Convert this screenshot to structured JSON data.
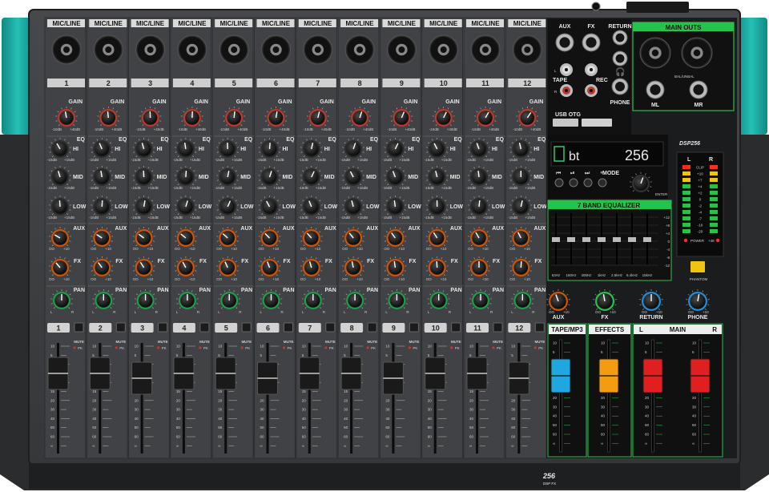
{
  "channels": {
    "input_label": "MIC/LINE",
    "numbers": [
      "1",
      "2",
      "3",
      "4",
      "5",
      "6",
      "7",
      "8",
      "9",
      "10",
      "11",
      "12"
    ],
    "gain_label": "GAIN",
    "gain_scale": [
      "-10dB",
      "+40dB"
    ],
    "eq_label": "EQ",
    "eq_bands": [
      "HI",
      "MID",
      "LOW"
    ],
    "eq_scale": [
      "-15dB",
      "+15dB"
    ],
    "aux_label": "AUX",
    "fx_label": "FX",
    "send_scale": [
      "OO",
      "+10"
    ],
    "pan_label": "PAN",
    "pan_scale": [
      "L",
      "R"
    ],
    "mute_label": "MUTE",
    "pk_label": "PK",
    "fader_scale": [
      "10",
      "5",
      "U",
      "5",
      "10",
      "15",
      "20",
      "30",
      "40",
      "50",
      "60",
      "∞"
    ]
  },
  "master": {
    "jacks": {
      "aux": "AUX",
      "fx": "FX",
      "return": "RETURN"
    },
    "main_outs": "MAIN OUTS",
    "tape": "TAPE",
    "rec": "REC",
    "phone": "PHONE",
    "bal_unbal": "BAL/UNBAL",
    "ml": "ML",
    "mr": "MR",
    "usb_otg": "USB OTG",
    "usb_port": "USB",
    "model": "DSP256",
    "display": {
      "left": "bt",
      "right": "256"
    },
    "mode": "MODE",
    "enter": "ENTER",
    "eq_title": "7 BAND EQUALIZER",
    "eq_freqs": [
      "63Hz",
      "160Hz",
      "400Hz",
      "1kHz",
      "2.5kHz",
      "6.4kHz",
      "15kHz"
    ],
    "eq_db": [
      "+12",
      "+8",
      "+4",
      "0",
      "-4",
      "-8",
      "-12"
    ],
    "meter_lr": [
      "L",
      "R"
    ],
    "meter_scale": [
      "CLIP",
      "+10",
      "+7",
      "+4",
      "+2",
      "0",
      "-2",
      "-4",
      "-7",
      "-10",
      "-20"
    ],
    "power": "POWER",
    "p48": "+48",
    "phantom": "PHANTOM",
    "knobs": [
      "AUX",
      "FX",
      "RETURN",
      "PHONE"
    ],
    "knob_scale": [
      "OO",
      "+10"
    ],
    "sections": {
      "tape": "TAPE/MP3",
      "effects": "EFFECTS",
      "main": "MAIN",
      "l": "L",
      "r": "R"
    },
    "colors": {
      "body": "#3d3f42",
      "accent": "#1aa8a0",
      "green": "#27c24c"
    }
  },
  "footer": {
    "model": "256",
    "sub": "DSP FX"
  }
}
